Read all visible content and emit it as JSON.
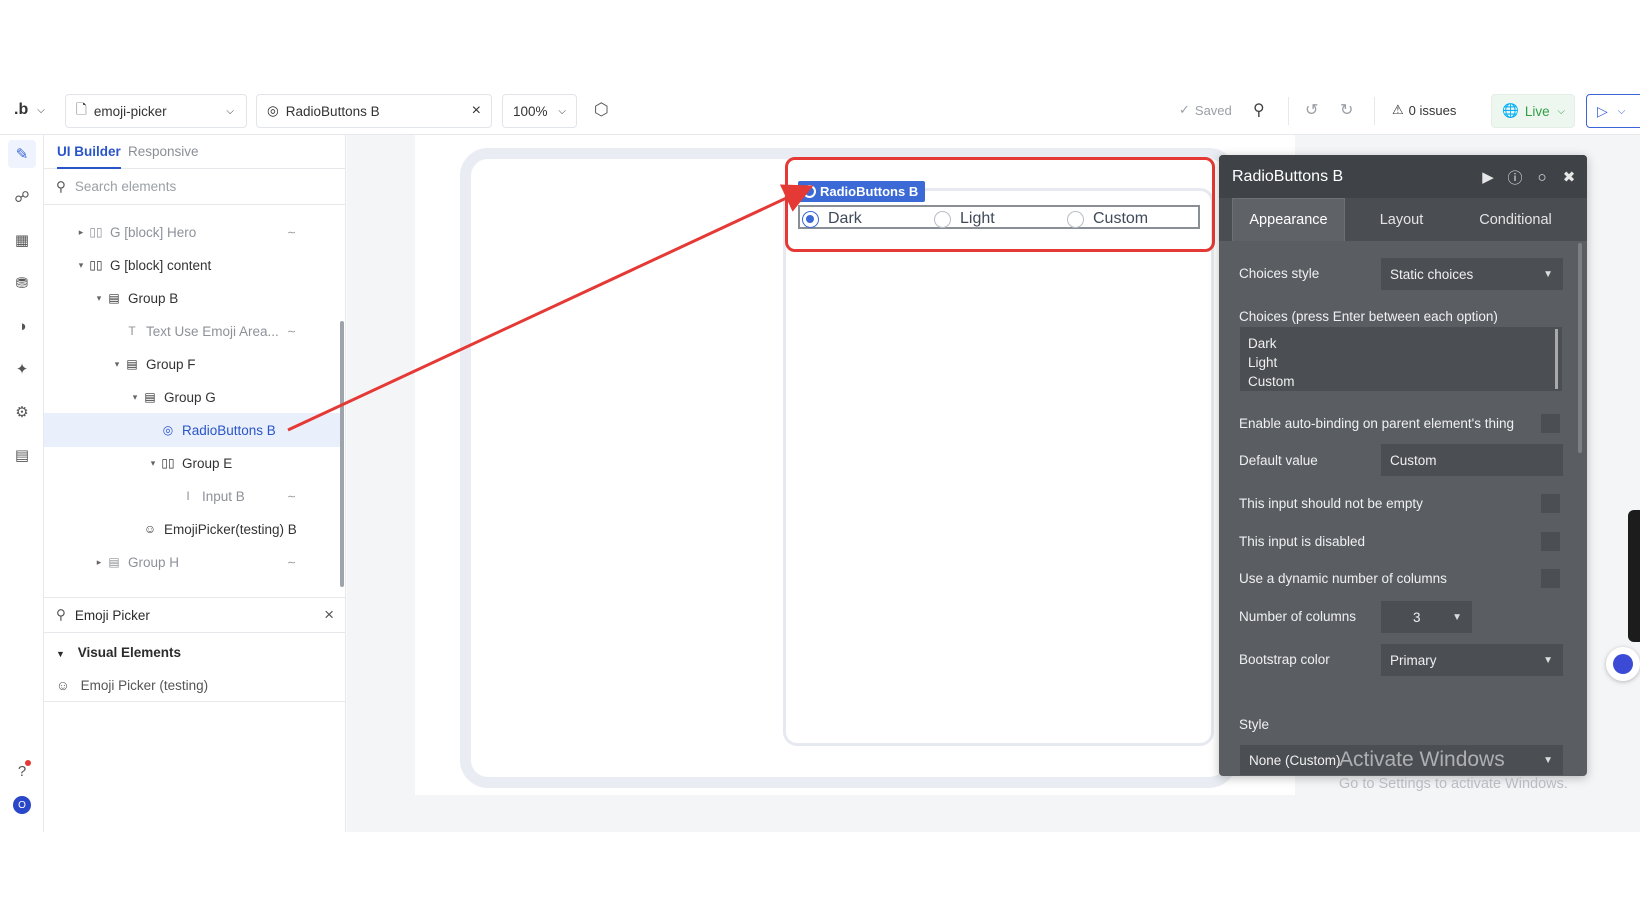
{
  "topbar": {
    "logo": ".b",
    "page_selector": "emoji-picker",
    "element_selector": "RadioButtons B",
    "zoom": "100%",
    "saved": "Saved",
    "issues": "0 issues",
    "live": "Live"
  },
  "tree_panel": {
    "tabs": [
      "UI Builder",
      "Responsive"
    ],
    "search_placeholder": "Search elements",
    "items": [
      {
        "label": "G [block] Hero",
        "icon": "columns-icon"
      },
      {
        "label": "G [block] content",
        "icon": "columns-icon"
      },
      {
        "label": "Group B",
        "icon": "rows-icon"
      },
      {
        "label": "Text Use Emoji Area...",
        "icon": "text-icon"
      },
      {
        "label": "Group F",
        "icon": "rows-icon"
      },
      {
        "label": "Group G",
        "icon": "rows-icon"
      },
      {
        "label": "RadioButtons B",
        "icon": "radio-icon"
      },
      {
        "label": "Group E",
        "icon": "columns-icon"
      },
      {
        "label": "Input B",
        "icon": "input-icon"
      },
      {
        "label": "EmojiPicker(testing) B",
        "icon": "emoji-icon"
      },
      {
        "label": "Group H",
        "icon": "rows-icon"
      }
    ],
    "library_search": "Emoji Picker",
    "library_heading": "Visual Elements",
    "library_item": "Emoji Picker (testing)"
  },
  "canvas": {
    "element_tag": "RadioButtons B",
    "options": [
      "Dark",
      "Light",
      "Custom"
    ],
    "selected_option": "Dark"
  },
  "property_editor": {
    "title": "RadioButtons B",
    "tabs": [
      "Appearance",
      "Layout",
      "Conditional"
    ],
    "choices_style_label": "Choices style",
    "choices_style_value": "Static choices",
    "choices_label": "Choices (press Enter between each option)",
    "choices": [
      "Dark",
      "Light",
      "Custom"
    ],
    "autobinding_label": "Enable auto-binding on parent element's thing",
    "default_value_label": "Default value",
    "default_value": "Custom",
    "not_empty_label": "This input should not be empty",
    "disabled_label": "This input is disabled",
    "dynamic_columns_label": "Use a dynamic number of columns",
    "num_columns_label": "Number of columns",
    "num_columns_value": "3",
    "bootstrap_label": "Bootstrap color",
    "bootstrap_value": "Primary",
    "style_label": "Style",
    "style_value": "None (Custom)"
  },
  "watermark": {
    "line1": "Activate Windows",
    "line2": "Go to Settings to activate Windows."
  },
  "colors": {
    "accent": "#3b6ad6",
    "highlight": "#e53935",
    "editor_bg": "#5a5e63"
  }
}
